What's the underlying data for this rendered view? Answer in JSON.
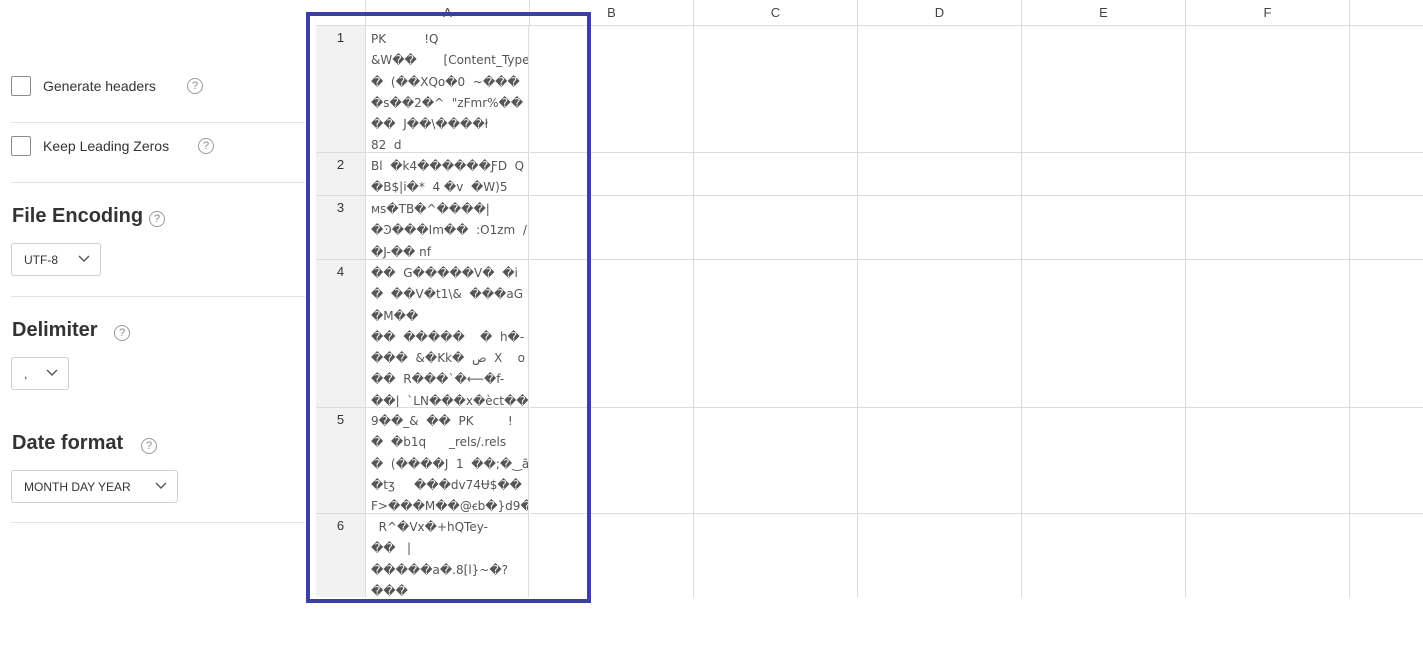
{
  "options": {
    "generate_headers": {
      "label": "Generate headers",
      "checked": false
    },
    "keep_leading_zeros": {
      "label": "Keep Leading Zeros",
      "checked": false
    }
  },
  "help_glyph": "?",
  "file_encoding": {
    "title": "File Encoding",
    "value": "UTF-8"
  },
  "delimiter": {
    "title": "Delimiter",
    "value": ","
  },
  "date_format": {
    "title": "Date format",
    "value": "MONTH DAY YEAR"
  },
  "grid": {
    "columns": [
      "A",
      "B",
      "C",
      "D",
      "E",
      "F"
    ],
    "rows": [
      {
        "num": "1",
        "a": "PK          !Q\n&W��       [Content_Types\n�  (��XQo�0  ~���\n�s��2�^  \"zFmr%��\n��  J��\\����ł\n82  d"
      },
      {
        "num": "2",
        "a": "Bl  �k4������ƑD  Q\n�B$|i�*  4 �v  �W)5"
      },
      {
        "num": "3",
        "a": "ᴍs�TB�^����|\n�Ͽ���Im��  :O1zm  /\n�J-�� nf"
      },
      {
        "num": "4",
        "a": "��  G�����V�  �i\n�  ��V�t1\\&  ���aG\n�M��\n��  �����    �  h�-\n���  &�Kk�  ص  X    o\n��  R���`�⟵�f-\n��|  `LN���x�èct��"
      },
      {
        "num": "5",
        "a": "9��_&  ��  PK         !\n�  �b1q      _rels/.rels\n�  (����J  1  ��;�‿ã\n�tʒ     ���dv74Ʉ$��\nF>���M��@ꞓb�}d9�"
      },
      {
        "num": "6",
        "a": "  R^�Vx�+hQTey-\n��   |\n�����a�.8[l}~�?\n���"
      }
    ]
  },
  "colors": {
    "highlight_border": "#3c3fa8",
    "row_header_bg": "#f2f2f2"
  }
}
